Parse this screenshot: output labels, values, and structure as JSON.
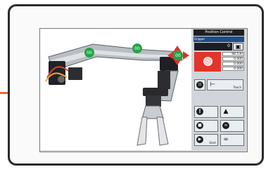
{
  "panel": {
    "title": "Position Control",
    "selector_label": "Gripper",
    "position_value": "0",
    "joint_values": [
      "98.530",
      "0.000",
      "0.000",
      "0.000"
    ]
  },
  "buttons": {
    "teach": "Teach",
    "toggle_top": "",
    "toggle_left_label": "",
    "toggle_right_label": "",
    "pause": "",
    "stop": "",
    "play": "Start",
    "home": "",
    "link": ""
  },
  "servos": [
    "00",
    "00",
    "00"
  ]
}
